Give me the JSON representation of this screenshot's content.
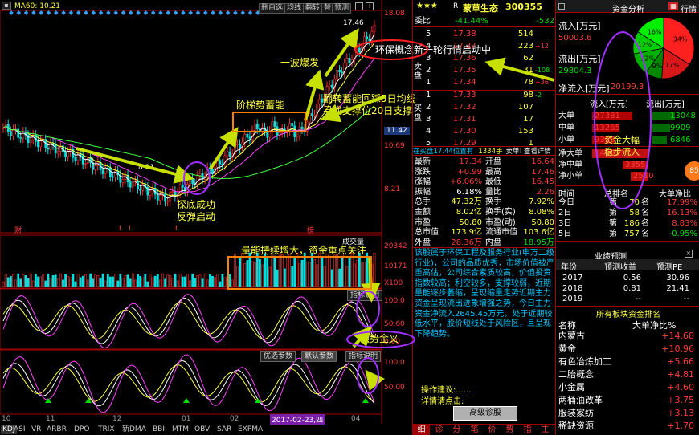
{
  "chart": {
    "ma_label": "MA60: 10.21",
    "toolbar": [
      "删自选",
      "均线",
      "翻转",
      "替",
      "预测"
    ],
    "price_high": "17.46",
    "price_low": "8.21",
    "y_labels": [
      "18.08",
      "11.42",
      "10.69",
      "8.21",
      "20342",
      "10171",
      "X100",
      "100.0",
      "50.60",
      "0.00",
      "100.0",
      "50.00"
    ],
    "volume_title": "成交量",
    "indicator_title": "指标说明",
    "param_buttons": [
      "优选参数",
      "默认参数",
      "指标说明"
    ],
    "month_labels": [
      "10",
      "11",
      "12",
      "01",
      "02",
      "03",
      "04"
    ],
    "date_label": "2017-02-23,四",
    "markers": [
      "财",
      "L",
      "L",
      "L",
      "榜"
    ],
    "bottom_tabs": [
      "KDJ",
      "ASI",
      "VR",
      "ARBR",
      "DPO",
      "TRIX",
      "新DMA",
      "BBI",
      "MTM",
      "OBV",
      "SAR",
      "EXPMA"
    ],
    "annotations": {
      "a1": "探底成功",
      "a2": "反弹启动",
      "a3": "阶梯势蓄能",
      "a4": "一波爆发",
      "a5": "翻转蓄能回踩5日均线",
      "a6": "寻找支撑位20日支撑",
      "a7": "环保概念新一轮行情启动中",
      "a8": "量能持续增大，资金重点关注",
      "a9": "强势金叉"
    }
  },
  "quote": {
    "stars": "★★★",
    "badge": "R",
    "name": "蒙草生态",
    "code": "300355",
    "weibi_label": "委比",
    "weibi_pct": "-41.44%",
    "weibi_val": "-532",
    "asks": [
      {
        "lv": "5",
        "p": "17.38",
        "v": "514",
        "c": ""
      },
      {
        "lv": "4",
        "p": "17.37",
        "v": "223",
        "c": "+12"
      },
      {
        "lv": "3",
        "p": "17.36",
        "v": "62",
        "c": ""
      },
      {
        "lv": "2",
        "p": "17.35",
        "v": "31",
        "c": "-108"
      },
      {
        "lv": "1",
        "p": "17.34",
        "v": "78",
        "c": "+36"
      }
    ],
    "bids": [
      {
        "lv": "1",
        "p": "17.33",
        "v": "98",
        "c": "-2"
      },
      {
        "lv": "2",
        "p": "17.32",
        "v": "107",
        "c": ""
      },
      {
        "lv": "3",
        "p": "17.31",
        "v": "17",
        "c": ""
      },
      {
        "lv": "4",
        "p": "17.30",
        "v": "153",
        "c": ""
      },
      {
        "lv": "5",
        "p": "17.29",
        "v": "1",
        "c": ""
      }
    ],
    "sell_label": "卖盘",
    "buy_label": "买盘",
    "trade_bar": {
      "a": "在买盘17.44位置有",
      "b": "1334手",
      "c": "卖单!",
      "d": "查看详情"
    },
    "stats": [
      [
        "最新",
        "17.34",
        "开盘",
        "16.64"
      ],
      [
        "涨跌",
        "+0.99",
        "最高",
        "17.46"
      ],
      [
        "涨幅",
        "+6.06%",
        "最低",
        "16.45"
      ],
      [
        "振幅",
        "6.18%",
        "量比",
        "2.26"
      ],
      [
        "总手",
        "47.32万",
        "换手",
        "7.92%"
      ],
      [
        "金额",
        "8.02亿",
        "换手(实)",
        "8.08%"
      ],
      [
        "市盈",
        "50.80",
        "市盈(动)",
        "50.80"
      ],
      [
        "总市值",
        "173.9亿",
        "流通市值",
        "103.6亿"
      ],
      [
        "外盘",
        "28.36万",
        "内盘",
        "18.95万"
      ]
    ],
    "desc": "该股属于环保工程及服务行业(申万二级行业)，公司的品质优秀，市场价值被严重高估，公司综合素质较高，价值投资指数较高；利空较多，支撑较弱，近期量能逐步萎缩，呈现缩量走势近期主力资金呈现流出迹象增强之势，今日主力资金净流入2645.45万元，处于近期较低水平，股价短线处于风险区，且呈现下降趋势。",
    "advice_label": "操作建议:......",
    "detail_label": "详情请点击:",
    "diag_button": "高级诊股",
    "bottom_tabs": [
      "细",
      "诊",
      "分",
      "笔",
      "价",
      "势",
      "指",
      "主"
    ]
  },
  "right": {
    "header": "资金分析",
    "nav_label": "行情",
    "inflow_label": "流入[万元]",
    "inflow_val": "50003.6",
    "outflow_label": "流出[万元]",
    "outflow_val": "29804.3",
    "net_label": "净流入[万元]",
    "net_val": "20199.3",
    "pie": [
      {
        "label": "34%",
        "value": 34,
        "color": "#ff2020"
      },
      {
        "label": "17%",
        "value": 17,
        "color": "#d81818"
      },
      {
        "label": "9%",
        "value": 9,
        "color": "#008800"
      },
      {
        "label": "12%",
        "value": 12,
        "color": "#00b000"
      },
      {
        "label": "12%",
        "value": 12,
        "color": "#00cc00"
      },
      {
        "label": "16%",
        "value": 16,
        "color": "#00ee00"
      }
    ],
    "flow_cols": [
      "流入[万元]",
      "流出[万元]"
    ],
    "flow_rows": [
      {
        "name": "大单",
        "in": "27381",
        "out": "13048"
      },
      {
        "name": "中单",
        "in": "13265",
        "out": "9909"
      },
      {
        "name": "小单",
        "in": "9358",
        "out": "6846"
      }
    ],
    "net_rows": [
      {
        "name": "净大单",
        "val": "14333"
      },
      {
        "name": "净中单",
        "val": "3355"
      },
      {
        "name": "净小单",
        "val": "2510"
      }
    ],
    "bubble": "85",
    "rank_cols": [
      "时间",
      "总排名",
      "大单净比"
    ],
    "rank_rows": [
      {
        "t": "今日",
        "r": "70",
        "p": "17.99%"
      },
      {
        "t": "2日",
        "r": "58",
        "p": "16.13%"
      },
      {
        "t": "3日",
        "r": "186",
        "p": "8.83%"
      },
      {
        "t": "5日",
        "r": "757",
        "p": "-0.95%"
      }
    ],
    "rank_prefix": "第",
    "rank_suffix": "名",
    "forecast_tab": "业绩预测",
    "forecast_cols": [
      "年份",
      "预测收益",
      "预测PE"
    ],
    "forecast_rows": [
      [
        "2017",
        "0.56",
        "30.96"
      ],
      [
        "2018",
        "0.81",
        "21.41"
      ],
      [
        "2019",
        "--",
        "--"
      ]
    ],
    "sector_title": "所有板块资金排名",
    "sector_cols": [
      "名称",
      "大单净比%"
    ],
    "sectors": [
      {
        "n": "内蒙古",
        "v": "+14.68"
      },
      {
        "n": "黄金",
        "v": "+10.96"
      },
      {
        "n": "有色冶炼加工",
        "v": "+5.66"
      },
      {
        "n": "二胎概念",
        "v": "+4.81"
      },
      {
        "n": "小金属",
        "v": "+4.60"
      },
      {
        "n": "两桶油改革",
        "v": "+3.75"
      },
      {
        "n": "服装家纺",
        "v": "+3.13"
      },
      {
        "n": "稀缺资源",
        "v": "+1.70"
      }
    ],
    "overlay1": "资金大幅",
    "overlay2": "稳步流入"
  }
}
